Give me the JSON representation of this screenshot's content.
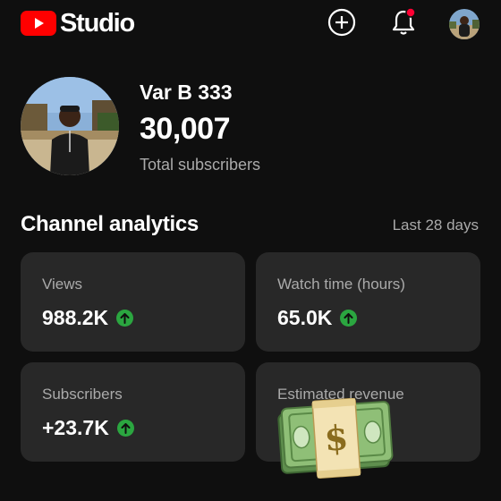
{
  "header": {
    "app_name": "Studio",
    "logo_icon": "youtube-play-icon",
    "create_icon": "plus-circle-icon",
    "notifications_icon": "bell-icon",
    "notification_dot_color": "#ff0033"
  },
  "profile": {
    "channel_name": "Var B 333",
    "subscriber_count": "30,007",
    "subscriber_label": "Total subscribers"
  },
  "analytics": {
    "title": "Channel analytics",
    "period": "Last 28 days",
    "cards": [
      {
        "label": "Views",
        "value": "988.2K",
        "trend": "up"
      },
      {
        "label": "Watch time (hours)",
        "value": "65.0K",
        "trend": "up"
      },
      {
        "label": "Subscribers",
        "value": "+23.7K",
        "trend": "up"
      },
      {
        "label": "Estimated revenue",
        "value": "",
        "overlay_icon": "money-bag-emoji-icon"
      }
    ]
  },
  "colors": {
    "background": "#0f0f0f",
    "card": "#282828",
    "brand_red": "#ff0000",
    "trend_up": "#2ba640"
  }
}
